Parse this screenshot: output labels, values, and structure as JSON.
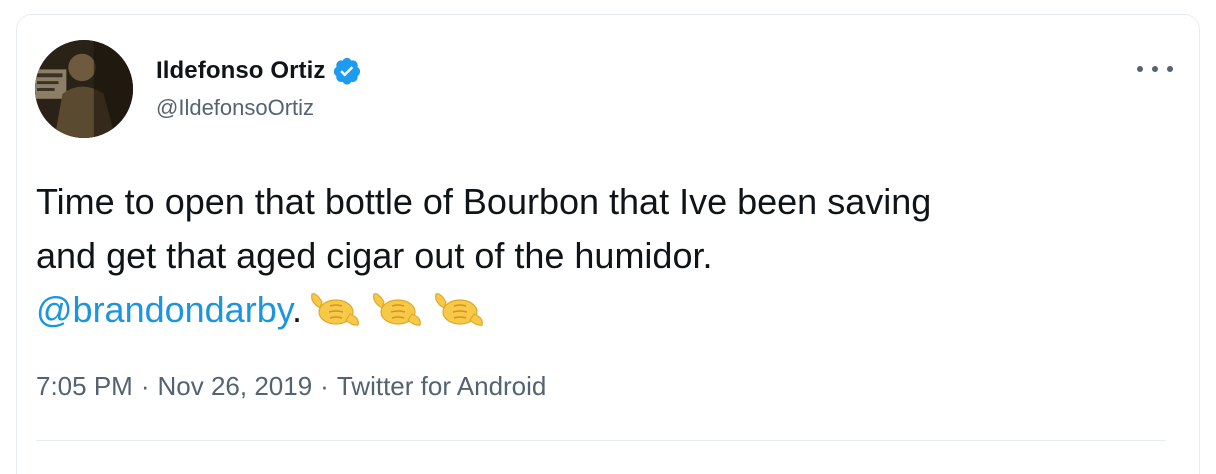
{
  "tweet": {
    "author_name": "Ildefonso Ortiz",
    "author_handle": "@IldefonsoOrtiz",
    "verified": true,
    "text_line1": "Time to open that bottle of Bourbon that Ive been saving",
    "text_line2": "and get that aged cigar out of the humidor.",
    "mention": "@brandondarby",
    "after_mention": ".",
    "emoji": [
      "call-me-hand-emoji",
      "call-me-hand-emoji",
      "call-me-hand-emoji"
    ],
    "time": "7:05 PM",
    "separator": "·",
    "date": "Nov 26, 2019",
    "source": "Twitter for Android"
  },
  "colors": {
    "text": "#0f1419",
    "secondary": "#536471",
    "link": "#1b95e0",
    "verified": "#1d9bf0",
    "border": "#e6ecf0",
    "emoji": "#f7c948"
  },
  "icons": {
    "verified": "verified-badge-icon",
    "more": "more-options-icon"
  }
}
